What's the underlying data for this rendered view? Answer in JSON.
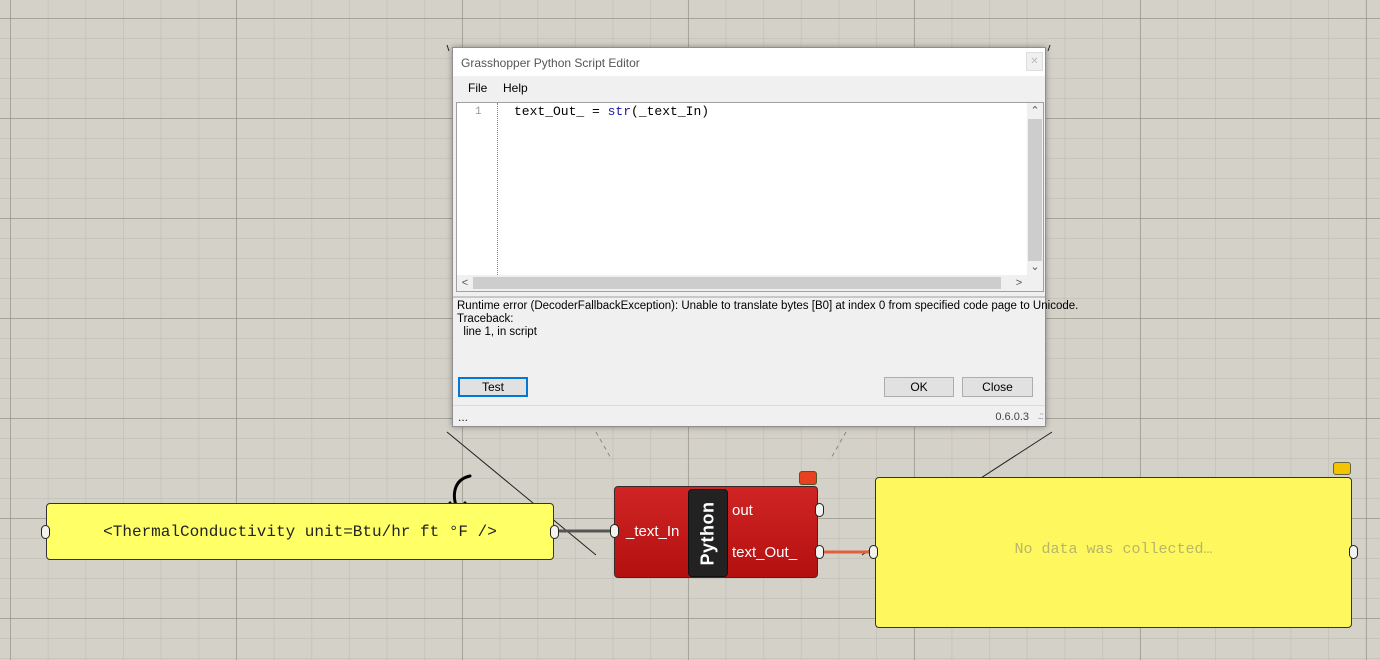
{
  "editor": {
    "title": "Grasshopper Python Script Editor",
    "close_icon": "✕",
    "menu": {
      "file": "File",
      "help": "Help"
    },
    "line_number": "1",
    "code": {
      "lhs": "text_Out_ = ",
      "func": "str",
      "args": "(_text_In)"
    },
    "output_lines": [
      "Runtime error (DecoderFallbackException): Unable to translate bytes [B0] at index 0 from specified code page to Unicode.",
      "Traceback:",
      "  line 1, in script"
    ],
    "buttons": {
      "test": "Test",
      "ok": "OK",
      "close": "Close"
    },
    "status": "...",
    "version": "0.6.0.3",
    "resize_grip": ".::"
  },
  "panel_input": {
    "text": "<ThermalConductivity unit=Btu/hr ft °F />"
  },
  "component": {
    "name": "Python",
    "inputs": [
      "_text_In"
    ],
    "outputs": [
      "out",
      "text_Out_"
    ]
  },
  "panel_output": {
    "text": "No data was collected…"
  },
  "colors": {
    "panel": "#ffff66",
    "component": "#c41818",
    "error_badge": "#e84020",
    "canvas": "#d4d1c8"
  }
}
